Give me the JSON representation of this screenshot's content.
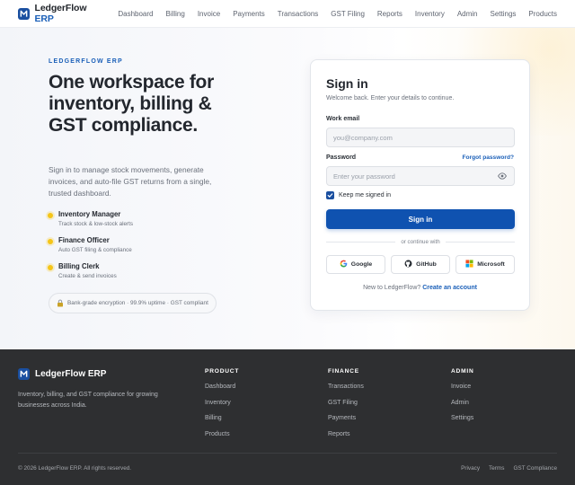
{
  "nav": {
    "brand": "LedgerFlow",
    "brand_accent": "ERP",
    "links": [
      "Dashboard",
      "Billing",
      "Invoice",
      "Payments",
      "Transactions",
      "GST Filing",
      "Reports",
      "Inventory",
      "Admin",
      "Settings",
      "Products"
    ]
  },
  "hero": {
    "eyebrow": "LEDGERFLOW ERP",
    "headline": "One workspace for inventory, billing & GST compliance.",
    "lead": "Sign in to manage stock movements, generate invoices, and auto-file GST returns from a single, trusted dashboard.",
    "features": [
      {
        "title": "Inventory Manager",
        "subtitle": "Track stock & low-stock alerts"
      },
      {
        "title": "Finance Officer",
        "subtitle": "Auto GST filing & compliance"
      },
      {
        "title": "Billing Clerk",
        "subtitle": "Create & send invoices"
      }
    ],
    "trust": "Bank-grade encryption · 99.9% uptime · GST compliant"
  },
  "signin": {
    "title": "Sign in",
    "subtitle": "Welcome back. Enter your details to continue.",
    "email_label": "Work email",
    "email_placeholder": "you@company.com",
    "password_label": "Password",
    "forgot": "Forgot password?",
    "password_placeholder": "Enter your password",
    "keep_signed": "Keep me signed in",
    "keep_signed_checked": true,
    "submit": "Sign in",
    "divider": "or continue with",
    "socials": [
      "Google",
      "GitHub",
      "Microsoft"
    ],
    "signup_prompt": "New to LedgerFlow?",
    "signup_link": "Create an account"
  },
  "footer": {
    "brand": "LedgerFlow ERP",
    "description": "Inventory, billing, and GST compliance for growing businesses across India.",
    "columns": [
      {
        "heading": "PRODUCT",
        "links": [
          "Dashboard",
          "Inventory",
          "Billing",
          "Products"
        ]
      },
      {
        "heading": "FINANCE",
        "links": [
          "Transactions",
          "GST Filing",
          "Payments",
          "Reports"
        ]
      },
      {
        "heading": "ADMIN",
        "links": [
          "Invoice",
          "Admin",
          "Settings"
        ]
      }
    ],
    "copyright": "© 2026 LedgerFlow ERP. All rights reserved.",
    "legal": [
      "Privacy",
      "Terms",
      "GST Compliance"
    ]
  },
  "colors": {
    "brand_blue": "#0f52b0",
    "accent_yellow": "#f5c518",
    "footer_bg": "#2e2f31"
  }
}
